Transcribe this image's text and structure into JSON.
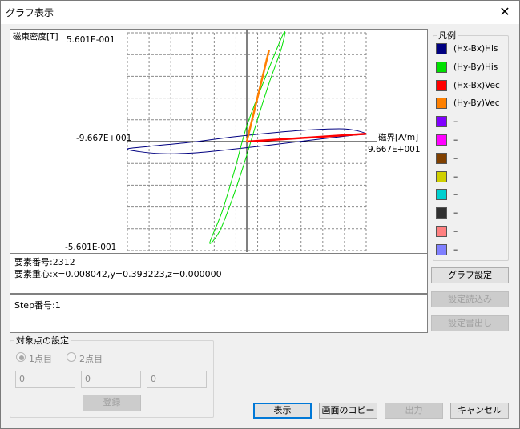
{
  "window": {
    "title": "グラフ表示",
    "close_glyph": "✕"
  },
  "chart_data": {
    "type": "line",
    "ylabel": "磁束密度[T]",
    "xlabel": "磁界[A/m]",
    "y_max_label": "5.601E-001",
    "y_min_label": "-5.601E-001",
    "x_min_label": "-9.667E+001",
    "x_max_label": "9.667E+001",
    "xlim": [
      -96.67,
      96.67
    ],
    "ylim": [
      -0.5601,
      0.5601
    ],
    "grid": true,
    "legend_placement": "right",
    "series": [
      {
        "name": "(Hx-Bx)His",
        "color": "#000080",
        "kind": "loop",
        "points": [
          [
            -96.67,
            -0.04
          ],
          [
            -70,
            -0.062
          ],
          [
            -40,
            -0.057
          ],
          [
            -10,
            -0.038
          ],
          [
            20,
            -0.017
          ],
          [
            55,
            0.01
          ],
          [
            85,
            0.032
          ],
          [
            96.67,
            0.04
          ],
          [
            80,
            0.065
          ],
          [
            50,
            0.06
          ],
          [
            20,
            0.045
          ],
          [
            -10,
            0.025
          ],
          [
            -45,
            -0.003
          ],
          [
            -80,
            -0.025
          ],
          [
            -96.67,
            -0.04
          ]
        ]
      },
      {
        "name": "(Hy-By)His",
        "color": "#00e000",
        "kind": "loop",
        "points": [
          [
            -30,
            -0.52
          ],
          [
            -20,
            -0.36
          ],
          [
            -10,
            -0.15
          ],
          [
            0,
            0.08
          ],
          [
            15,
            0.33
          ],
          [
            30,
            0.56
          ],
          [
            28,
            0.48
          ],
          [
            18,
            0.3
          ],
          [
            8,
            0.1
          ],
          [
            -2,
            -0.11
          ],
          [
            -12,
            -0.3
          ],
          [
            -22,
            -0.46
          ],
          [
            -30,
            -0.52
          ]
        ]
      },
      {
        "name": "(Hx-Bx)Vec",
        "color": "#ff0000",
        "kind": "line",
        "points": [
          [
            0,
            0
          ],
          [
            96.67,
            0.04
          ]
        ]
      },
      {
        "name": "(Hy-By)Vec",
        "color": "#ff8000",
        "kind": "line",
        "points": [
          [
            0,
            0
          ],
          [
            18,
            0.47
          ]
        ]
      },
      {
        "name": "–",
        "color": "#8000ff"
      },
      {
        "name": "–",
        "color": "#ff00ff"
      },
      {
        "name": "–",
        "color": "#804000"
      },
      {
        "name": "–",
        "color": "#d0d000"
      },
      {
        "name": "–",
        "color": "#00d0d0"
      },
      {
        "name": "–",
        "color": "#303030"
      },
      {
        "name": "–",
        "color": "#ff8080"
      },
      {
        "name": "–",
        "color": "#8080ff"
      }
    ]
  },
  "info": {
    "element_number": "要素番号:2312",
    "element_centroid": "要素重心:x=0.008042,y=0.393223,z=0.000000",
    "step_number": "Step番号:1"
  },
  "legend": {
    "title": "凡例"
  },
  "buttons": {
    "graph_settings": "グラフ設定",
    "load_settings": "設定読込み",
    "save_settings": "設定書出し",
    "display": "表示",
    "copy_screen": "画面のコピー",
    "output": "出力",
    "cancel": "キャンセル",
    "register": "登録"
  },
  "target_group": {
    "title": "対象点の設定",
    "radio1": "1点目",
    "radio2": "2点目",
    "field1": "0",
    "field2": "0",
    "field3": "0"
  }
}
